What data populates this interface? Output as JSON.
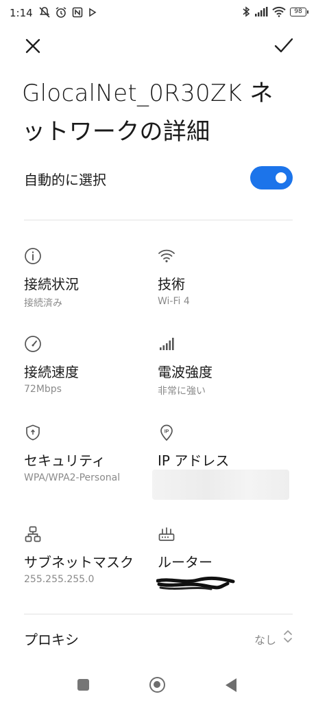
{
  "status_bar": {
    "time": "1:14",
    "battery": "98"
  },
  "header": {
    "close_icon": "close-icon",
    "confirm_icon": "check-icon"
  },
  "title": "GlocalNet_0R30ZK ネットワークの詳細",
  "auto_select": {
    "label": "自動的に選択",
    "enabled": true,
    "accent_color": "#1c74ea"
  },
  "details": [
    {
      "icon": "info-icon",
      "label": "接続状況",
      "value": "接続済み"
    },
    {
      "icon": "wifi-icon",
      "label": "技術",
      "value": "Wi-Fi 4"
    },
    {
      "icon": "speedometer-icon",
      "label": "接続速度",
      "value": "72Mbps"
    },
    {
      "icon": "signal-strength-icon",
      "label": "電波強度",
      "value": "非常に強い"
    },
    {
      "icon": "shield-icon",
      "label": "セキュリティ",
      "value": "WPA/WPA2-Personal"
    },
    {
      "icon": "ip-pin-icon",
      "label": "IP アドレス",
      "value": ""
    },
    {
      "icon": "subnet-icon",
      "label": "サブネットマスク",
      "value": "255.255.255.0"
    },
    {
      "icon": "router-icon",
      "label": "ルーター",
      "value": ""
    }
  ],
  "proxy": {
    "label": "プロキシ",
    "value": "なし"
  }
}
